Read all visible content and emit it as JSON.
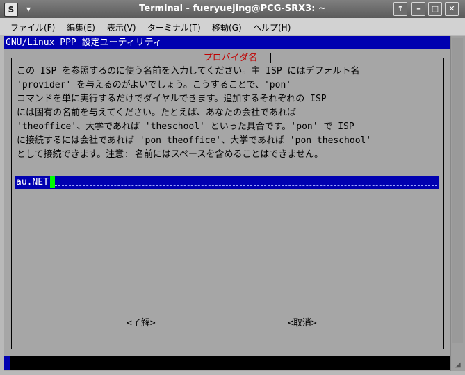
{
  "window": {
    "title": "Terminal - fueryuejing@PCG-SRX3: ~",
    "app_icon_glyph": "S",
    "menu_arrow_glyph": "▾",
    "btn_up": "↑",
    "btn_min": "–",
    "btn_max": "□",
    "btn_close": "✕"
  },
  "menubar": {
    "items": [
      "ファイル(F)",
      "編集(E)",
      "表示(V)",
      "ターミナル(T)",
      "移動(G)",
      "ヘルプ(H)"
    ]
  },
  "terminal": {
    "top_title": "GNU/Linux PPP 設定ユーティリティ",
    "dialog_caption": "プロバイダ名",
    "body_lines": [
      "この ISP を参照するのに使う名前を入力してください。主 ISP にはデフォルト名",
      "'provider' を与えるのがよいでしょう。こうすることで、'pon'",
      "コマンドを単に実行するだけでダイヤルできます。追加するそれぞれの ISP",
      "には固有の名前を与えてください。たとえば、あなたの会社であれば",
      "'theoffice'、大学であれば 'theschool' といった具合です。'pon' で ISP",
      "に接続するには会社であれば 'pon theoffice'、大学であれば 'pon theschool'",
      "として接続できます。注意: 名前にはスペースを含めることはできません。"
    ],
    "input_value": "au.NET",
    "ok_label": "<了解>",
    "cancel_label": "<取消>"
  },
  "colors": {
    "dialog_bg": "#a6a6a6",
    "highlight_blue": "#0000b0",
    "caption_red": "#c00000",
    "cursor_green": "#00ff00"
  }
}
